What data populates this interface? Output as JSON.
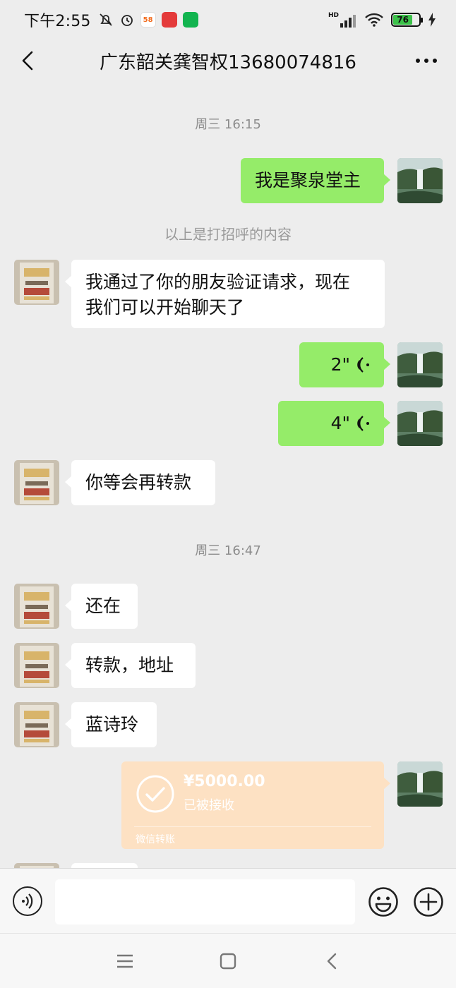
{
  "status_bar": {
    "time": "下午2:55",
    "app_58_label": "58",
    "battery_level": "76",
    "network": "HD"
  },
  "header": {
    "title": "广东韶关龚智权13680074816"
  },
  "messages": {
    "ts1": "周三 16:15",
    "m1": "我是聚泉堂主",
    "sys1": "以上是打招呼的内容",
    "m2_line1": "我通过了你的朋友验证请求，现在",
    "m2_line2": "我们可以开始聊天了",
    "voice1": "2\"",
    "voice2": "4\"",
    "m3": "你等会再转款",
    "ts2": "周三 16:47",
    "m4": "还在",
    "m5": "转款，地址",
    "m6": "蓝诗玲",
    "transfer": {
      "amount": "¥5000.00",
      "status": "已被接收",
      "label": "微信转账"
    }
  },
  "colors": {
    "outgoing_bubble": "#95ec69",
    "incoming_bubble": "#ffffff",
    "transfer_card": "#fde1c3",
    "background": "#ededed"
  },
  "icons": {
    "back": "chevron-left-icon",
    "more": "more-dots-icon",
    "voice_input": "voice-input-icon",
    "emoji": "emoji-icon",
    "plus": "plus-icon"
  }
}
